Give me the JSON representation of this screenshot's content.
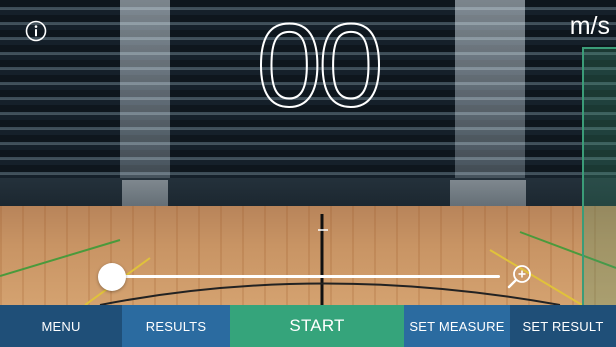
{
  "display": {
    "speed_value": "00",
    "unit": "m/s"
  },
  "icons": {
    "info": "info-icon",
    "zoom": "zoom-in-icon"
  },
  "zoom_slider": {
    "level": 0.0
  },
  "toolbar": {
    "menu_label": "MENU",
    "results_label": "RESULTS",
    "start_label": "START",
    "set_measure_label": "SET MEASURE",
    "set_result_label": "SET RESULT"
  },
  "colors": {
    "toolbar_dark": "#1f4f78",
    "toolbar_mid": "#2b6ba0",
    "start_green": "#35a47b",
    "measure_zone": "#3b9c78"
  }
}
